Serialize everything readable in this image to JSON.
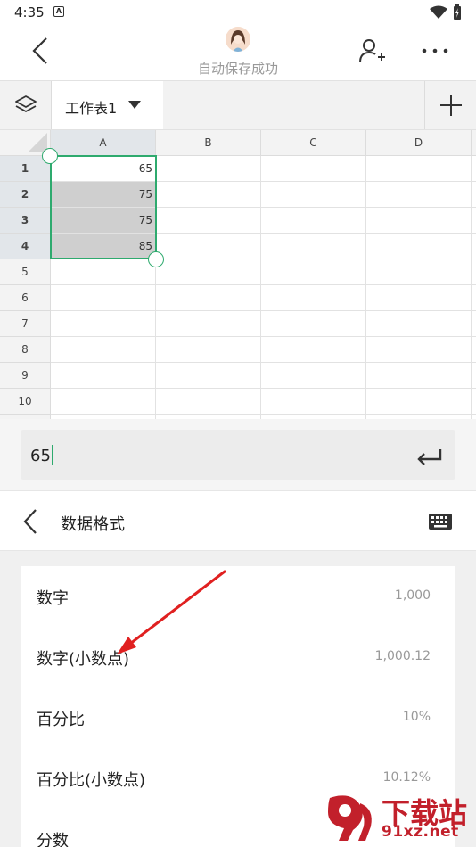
{
  "status_bar": {
    "time": "4:35",
    "notification_icon": "A"
  },
  "app_bar": {
    "save_status": "自动保存成功",
    "icons": [
      "back-arrow-icon",
      "avatar",
      "add-user-icon",
      "more-icon"
    ]
  },
  "sheet_bar": {
    "active_sheet": "工作表1"
  },
  "grid": {
    "columns": [
      "A",
      "B",
      "C",
      "D"
    ],
    "rows": [
      "1",
      "2",
      "3",
      "4",
      "5",
      "6",
      "7",
      "8",
      "9",
      "10"
    ],
    "column_a_values": [
      "65",
      "75",
      "75",
      "85"
    ],
    "selection": "A1:A4"
  },
  "edit_bar": {
    "value": "65"
  },
  "format_panel": {
    "title": "数据格式",
    "options": [
      {
        "label": "数字",
        "sample": "1,000"
      },
      {
        "label": "数字(小数点)",
        "sample": "1,000.12"
      },
      {
        "label": "百分比",
        "sample": "10%"
      },
      {
        "label": "百分比(小数点)",
        "sample": "10.12%"
      },
      {
        "label": "分数",
        "sample": ""
      }
    ]
  },
  "watermark": {
    "brand": "下载站",
    "url": "91xz.net"
  },
  "colors": {
    "accent": "#2eaa6e",
    "selected_cell": "#cfcfcf",
    "annotation": "#e02020",
    "watermark": "#c2202b"
  }
}
